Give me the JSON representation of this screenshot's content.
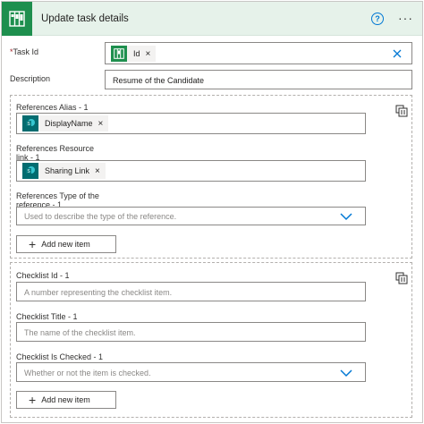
{
  "header": {
    "title": "Update task details",
    "help_label": "?",
    "more_label": "···"
  },
  "task_id": {
    "label": "Task Id",
    "required_mark": "*",
    "token": "Id",
    "token_remove": "×"
  },
  "description": {
    "label": "Description",
    "value": "Resume of the Candidate"
  },
  "references": {
    "alias_label": "References Alias - 1",
    "alias_token": "DisplayName",
    "alias_token_remove": "×",
    "resource_label_line1": "References Resource",
    "resource_label_line2": "link - 1",
    "resource_token": "Sharing Link",
    "resource_token_remove": "×",
    "type_label_line1": "References Type of the",
    "type_label_line2": "reference - 1",
    "type_placeholder": "Used to describe the type of the reference.",
    "add_item_label": "Add new item",
    "add_item_plus": "+"
  },
  "checklist": {
    "id_label": "Checklist Id - 1",
    "id_placeholder": "A number representing the checklist item.",
    "title_label": "Checklist Title - 1",
    "title_placeholder": "The name of the checklist item.",
    "checked_label": "Checklist Is Checked - 1",
    "checked_placeholder": "Whether or not the item is checked.",
    "add_item_label": "Add new item",
    "add_item_plus": "+"
  },
  "colors": {
    "brand_green": "#1e8f4e",
    "header_bg": "#e6f2ea",
    "sharepoint_teal": "#036c70",
    "accent_blue": "#0078d4"
  },
  "icons": {
    "app": "planner-icon",
    "token_id": "planner-icon",
    "token_sharepoint": "sharepoint-icon",
    "panel": "delete-icon",
    "dropdown": "chevron-down-icon",
    "clear": "close-icon"
  }
}
